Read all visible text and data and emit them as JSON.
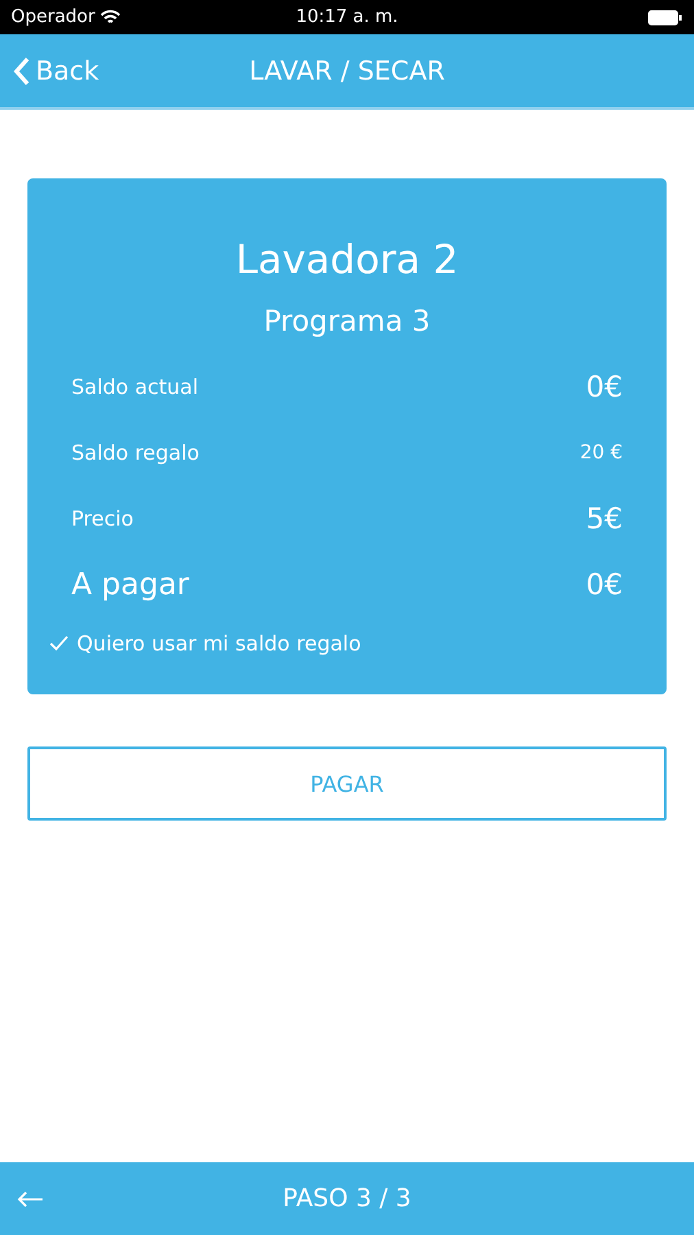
{
  "status_bar": {
    "carrier": "Operador",
    "time": "10:17 a. m."
  },
  "nav": {
    "back": "Back",
    "title": "LAVAR / SECAR"
  },
  "card": {
    "machine": "Lavadora 2",
    "program": "Programa 3",
    "rows": [
      {
        "kind": "normal",
        "label": "Saldo actual",
        "value": "0€"
      },
      {
        "kind": "small",
        "label": "Saldo regalo",
        "value": "20 €"
      },
      {
        "kind": "normal",
        "label": "Precio",
        "value": "5€"
      },
      {
        "kind": "total",
        "label": "A pagar",
        "value": "0€"
      }
    ],
    "gift_option": {
      "label": "Quiero usar mi saldo regalo",
      "checked": true
    }
  },
  "pay_button": "PAGAR",
  "footer": {
    "step": "PASO 3 / 3"
  }
}
